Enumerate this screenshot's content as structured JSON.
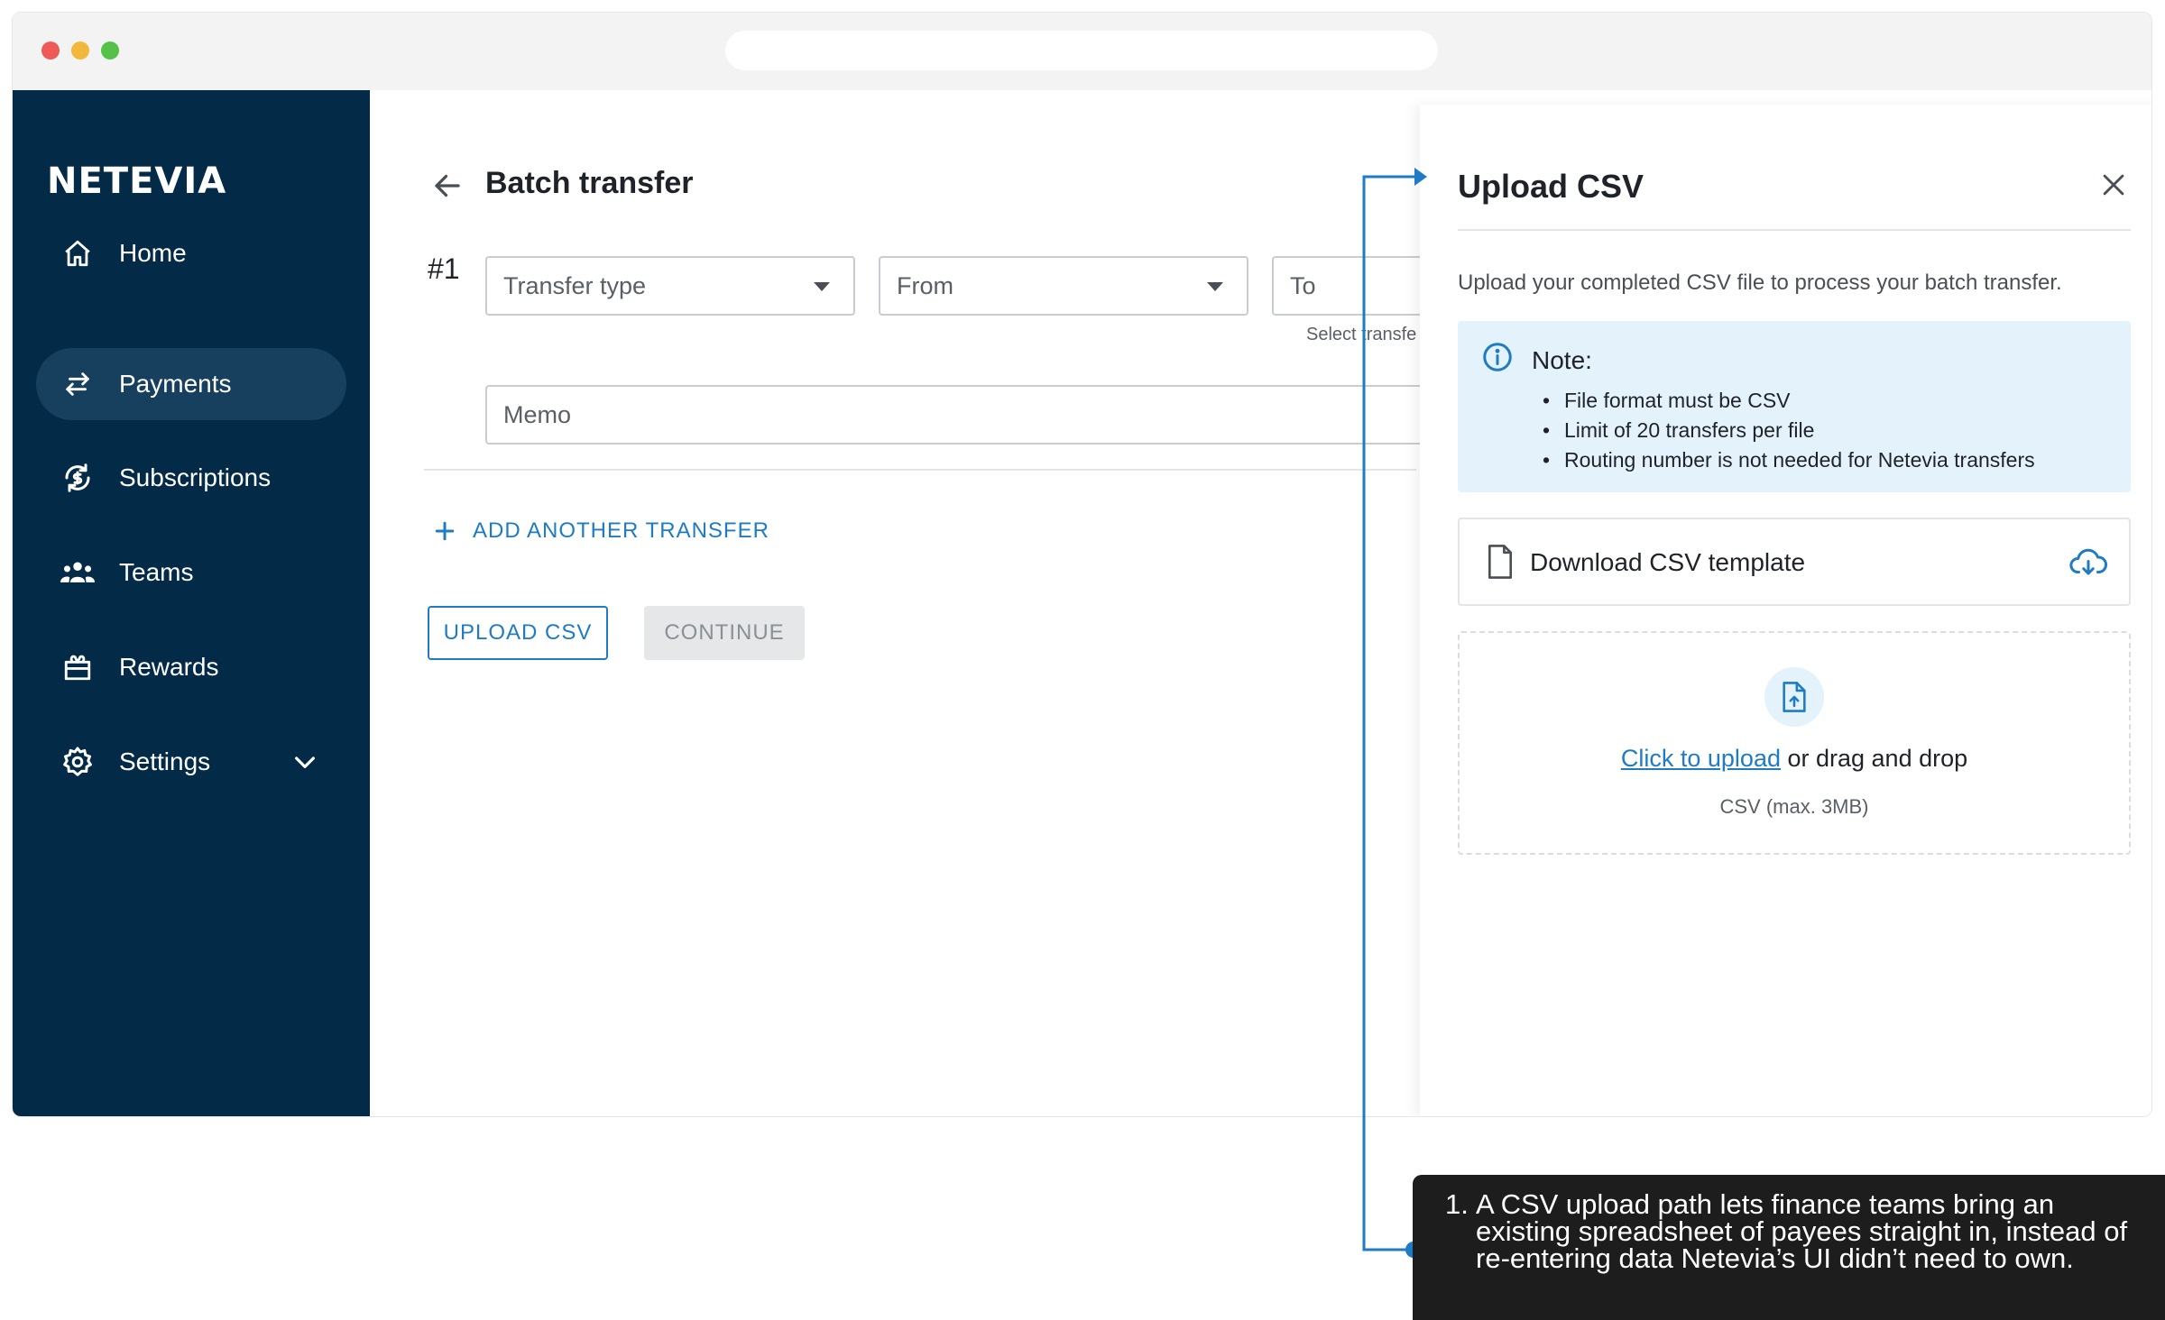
{
  "sidebar": {
    "logo": "NETEVIA",
    "items": [
      {
        "label": "Home",
        "icon": "home-icon"
      },
      {
        "label": "Payments",
        "icon": "transfer-arrows-icon",
        "active": true
      },
      {
        "label": "Subscriptions",
        "icon": "subscription-refresh-icon"
      },
      {
        "label": "Teams",
        "icon": "team-icon"
      },
      {
        "label": "Rewards",
        "icon": "gift-icon"
      },
      {
        "label": "Settings",
        "icon": "gear-icon",
        "expandable": true
      }
    ]
  },
  "main": {
    "title": "Batch transfer",
    "transfer_index": "#1",
    "fields": {
      "transfer_type_placeholder": "Transfer type",
      "from_placeholder": "From",
      "to_placeholder": "To",
      "to_helper": "Select transfe",
      "memo_placeholder": "Memo"
    },
    "add_transfer_label": "ADD ANOTHER TRANSFER",
    "upload_csv_label": "UPLOAD CSV",
    "continue_label": "CONTINUE"
  },
  "drawer": {
    "title": "Upload CSV",
    "description": "Upload your completed CSV file to process your batch transfer.",
    "note": {
      "title": "Note:",
      "items": [
        "File format must be CSV",
        "Limit of 20 transfers per file",
        "Routing number is not needed for Netevia transfers"
      ]
    },
    "download_label": "Download CSV template",
    "dropzone": {
      "link_text": "Click to upload",
      "rest_text": " or drag and drop",
      "hint": "CSV (max. 3MB)"
    }
  },
  "annotation": {
    "number": "1.",
    "text": "A CSV upload path lets finance teams bring an existing spreadsheet of payees straight in, instead of re-entering data Netevia’s UI didn’t need to own."
  },
  "colors": {
    "sidebar_bg": "#032b47",
    "sidebar_active": "#17405e",
    "accent_blue": "#1e7bc4",
    "note_bg": "#e3f2fb",
    "callout_bg": "#1d1d1d"
  }
}
